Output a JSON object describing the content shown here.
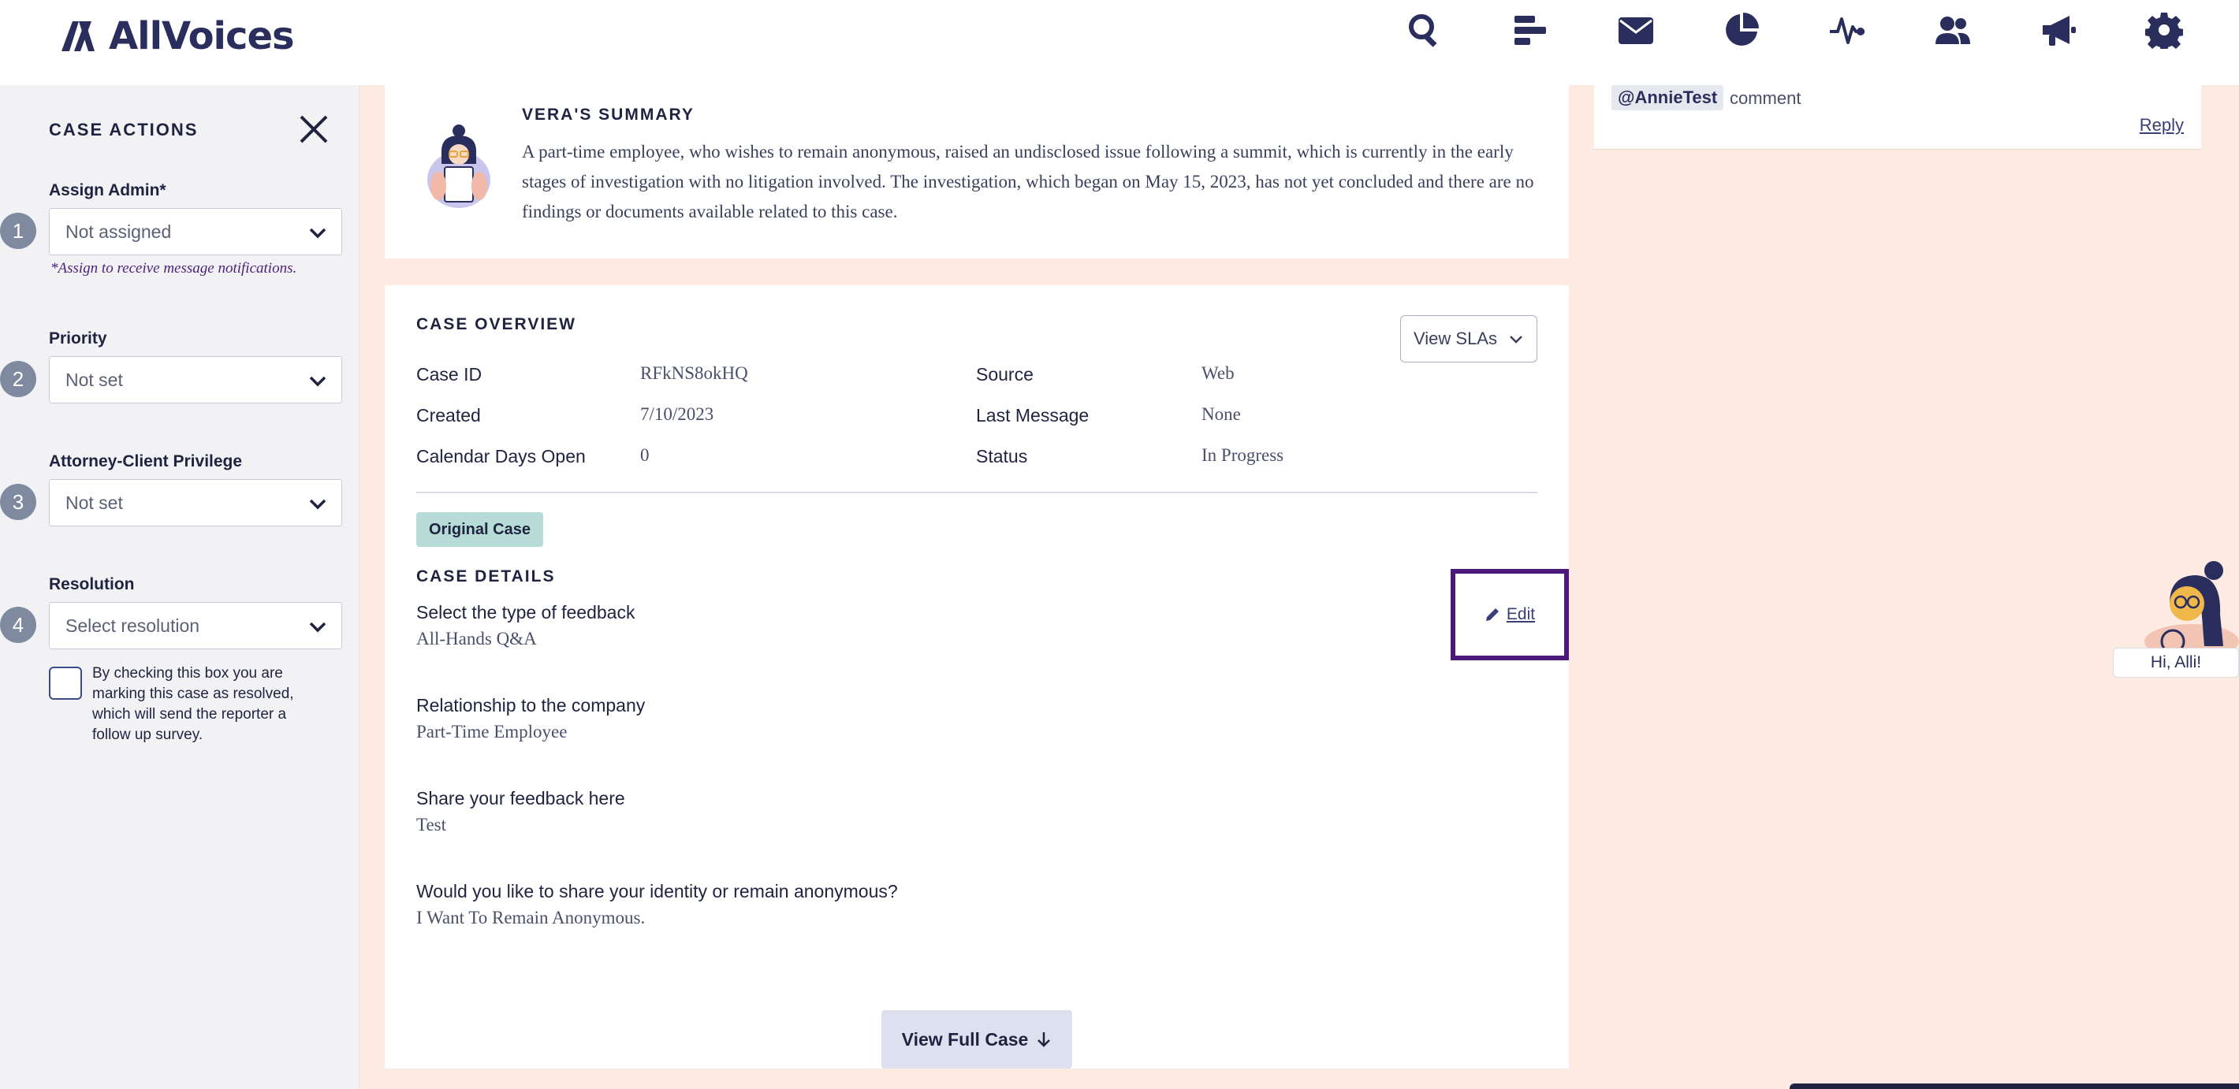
{
  "header": {
    "logo_text": "AllVoices",
    "nav_icons": [
      "search-icon",
      "bars-icon",
      "envelope-icon",
      "pie-chart-icon",
      "activity-icon",
      "users-icon",
      "megaphone-icon",
      "gear-icon"
    ]
  },
  "sidebar": {
    "title": "CASE ACTIONS",
    "fields": [
      {
        "step": "1",
        "label": "Assign Admin*",
        "value": "Not assigned"
      },
      {
        "step": "2",
        "label": "Priority",
        "value": "Not set"
      },
      {
        "step": "3",
        "label": "Attorney-Client Privilege",
        "value": "Not set"
      },
      {
        "step": "4",
        "label": "Resolution",
        "value": "Select resolution"
      }
    ],
    "assign_hint": "*Assign to receive message notifications.",
    "resolve_checkbox_text": "By checking this box you are marking this case as resolved, which will send the reporter a follow up survey."
  },
  "summary": {
    "title": "VERA'S SUMMARY",
    "text": "A part-time employee, who wishes to remain anonymous, raised an undisclosed issue following a summit, which is currently in the early stages of investigation with no litigation involved. The investigation, which began on May 15, 2023, has not yet concluded and there are no findings or documents available related to this case."
  },
  "overview": {
    "title": "CASE OVERVIEW",
    "sla_button": "View SLAs",
    "left_fields": [
      {
        "key": "Case ID",
        "value": "RFkNS8okHQ"
      },
      {
        "key": "Created",
        "value": "7/10/2023"
      },
      {
        "key": "Calendar Days Open",
        "value": "0"
      }
    ],
    "right_fields": [
      {
        "key": "Source",
        "value": "Web"
      },
      {
        "key": "Last Message",
        "value": "None"
      },
      {
        "key": "Status",
        "value": "In Progress"
      }
    ],
    "badge": "Original Case",
    "details_title": "CASE DETAILS",
    "edit_label": "Edit",
    "questions": [
      {
        "label": "Select the type of feedback",
        "value": "All-Hands Q&A"
      },
      {
        "label": "Relationship to the company",
        "value": "Part-Time Employee"
      },
      {
        "label": "Share your feedback here",
        "value": "Test"
      },
      {
        "label": "Would you like to share your identity or remain anonymous?",
        "value": "I Want To Remain Anonymous."
      }
    ],
    "full_case_button": "View Full Case"
  },
  "comment": {
    "mention": "@AnnieTest",
    "text": "comment",
    "reply": "Reply"
  },
  "helper": {
    "greeting": "Hi, Alli!"
  }
}
